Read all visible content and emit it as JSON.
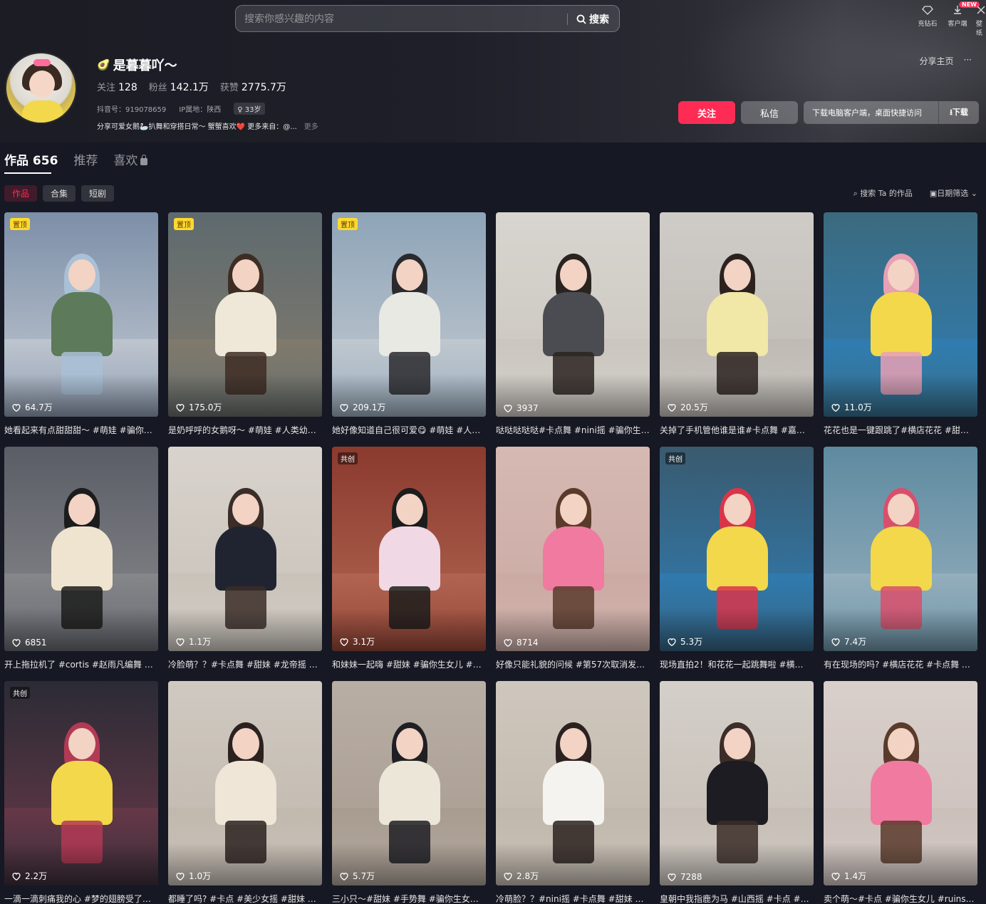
{
  "search": {
    "placeholder": "搜索你感兴趣的内容",
    "button_label": "搜索"
  },
  "top_icons": [
    {
      "icon": "diamond-icon",
      "label": "充钻石"
    },
    {
      "icon": "download-icon",
      "label": "客户端",
      "badge": "NEW"
    },
    {
      "icon": "wallpaper-icon",
      "label": "壁纸"
    }
  ],
  "profile": {
    "emoji": "🥑",
    "nickname": "是暮暮吖～",
    "following_label": "关注",
    "following": "128",
    "fans_label": "粉丝",
    "fans": "142.1万",
    "likes_label": "获赞",
    "likes": "2775.7万",
    "douyin_id": "抖音号：919078659",
    "ip": "IP属地：陕西",
    "age": "33岁",
    "bio": "分享可爱女鹅🦢扒舞和穿搭日常～ 蟹蟹喜欢❤️ 更多来自：@...",
    "bio_more": "更多"
  },
  "share": {
    "label": "分享主页",
    "more": "···"
  },
  "actions": {
    "follow": "关注",
    "message": "私信",
    "download_text": "下载电脑客户端，桌面快捷访问",
    "download_btn": "⭳下载"
  },
  "tabs": [
    {
      "label": "作品 656"
    },
    {
      "label": "推荐"
    },
    {
      "label": "喜欢"
    }
  ],
  "subtabs": [
    "作品",
    "合集",
    "短剧"
  ],
  "tools": {
    "search_works": "搜索 Ta 的作品",
    "date_filter": "日期筛选"
  },
  "colors": {
    "accent": "#fe2c55",
    "background": "#161823"
  },
  "videos": [
    {
      "tag": "置顶",
      "likes": "64.7万",
      "caption": "她看起来有点甜甜甜～ #萌娃 #骗你…"
    },
    {
      "tag": "置顶",
      "likes": "175.0万",
      "caption": "是奶呼呼的女鹅呀～ #萌娃 #人类幼…"
    },
    {
      "tag": "置顶",
      "likes": "209.1万",
      "caption": "她好像知道自己很可爱😋 #萌娃 #人…"
    },
    {
      "tag": "",
      "likes": "3937",
      "caption": "哒哒哒哒哒#卡点舞 #nini摇 #骗你生…"
    },
    {
      "tag": "",
      "likes": "20.5万",
      "caption": "关掉了手机管他谁是谁#卡点舞 #嘉…"
    },
    {
      "tag": "",
      "likes": "11.0万",
      "caption": "花花也是一键跟跳了#横店花花 #甜…"
    },
    {
      "tag": "",
      "likes": "6851",
      "caption": "开上拖拉机了 #cortis #赵雨凡编舞 #…"
    },
    {
      "tag": "",
      "likes": "1.1万",
      "caption": "冷脸萌？？#卡点舞 #甜妹 #龙帝摇 #…"
    },
    {
      "tag": "共创",
      "likes": "3.1万",
      "caption": "和妹妹一起嗨 #甜妹 #骗你生女儿 #…"
    },
    {
      "tag": "",
      "likes": "8714",
      "caption": "好像只能礼貌的问候 #第57次取消发…"
    },
    {
      "tag": "共创",
      "likes": "5.3万",
      "caption": "现场直拍2！和花花一起跳舞啦 #横…"
    },
    {
      "tag": "",
      "likes": "7.4万",
      "caption": "有在现场的吗? #横店花花 #卡点舞 …"
    },
    {
      "tag": "共创",
      "likes": "2.2万",
      "caption": "一滴一滴刺痛我的心 #梦的翅膀受了…"
    },
    {
      "tag": "",
      "likes": "1.0万",
      "caption": "都睡了吗? #卡点 #美少女摇 #甜妹 #…"
    },
    {
      "tag": "",
      "likes": "5.7万",
      "caption": "三小只～#甜妹 #手势舞 #骗你生女…"
    },
    {
      "tag": "",
      "likes": "2.8万",
      "caption": "冷萌脸？？#nini摇 #卡点舞 #甜妹 #…"
    },
    {
      "tag": "",
      "likes": "7288",
      "caption": "皇朝中我指鹿为马 #山西摇 #卡点 #…"
    },
    {
      "tag": "",
      "likes": "1.4万",
      "caption": "卖个萌～#卡点 #骗你生女儿 #ruins…"
    }
  ]
}
